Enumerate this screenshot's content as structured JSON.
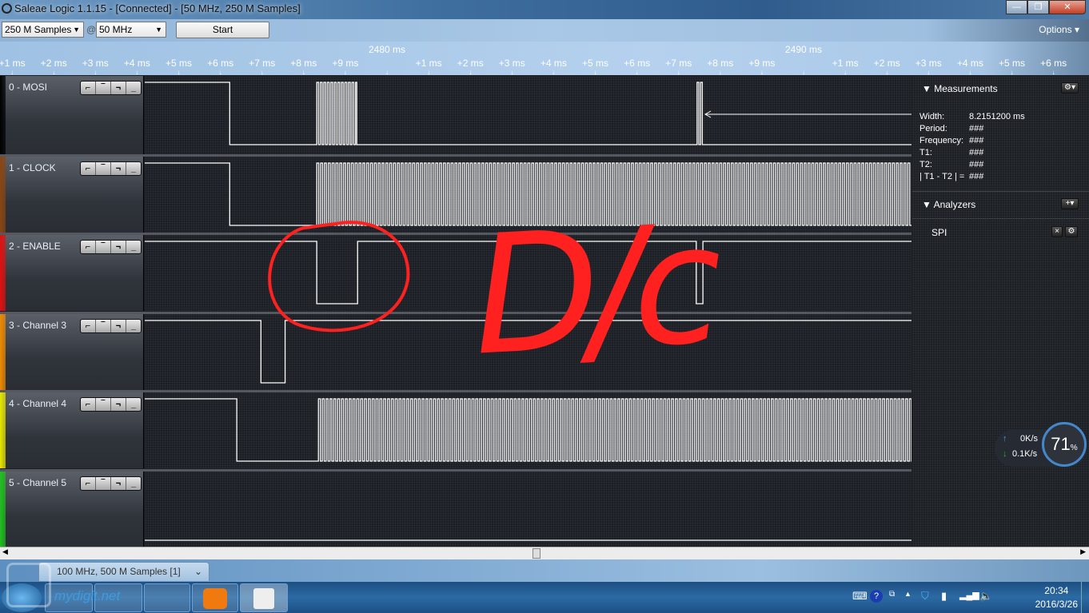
{
  "window": {
    "title": "Saleae Logic 1.1.15 - [Connected] - [50 MHz, 250 M Samples]"
  },
  "toolbar": {
    "samples": "250 M Samples",
    "at": "@",
    "rate": "50 MHz",
    "start_label": "Start",
    "options_label": "Options ▾"
  },
  "ruler": {
    "first_tick_ms": 2471,
    "ticks": [
      "+1 ms",
      "+2 ms",
      "+3 ms",
      "+4 ms",
      "+5 ms",
      "+6 ms",
      "+7 ms",
      "+8 ms",
      "+9 ms",
      "",
      "+1 ms",
      "+2 ms",
      "+3 ms",
      "+4 ms",
      "+5 ms",
      "+6 ms",
      "+7 ms",
      "+8 ms",
      "+9 ms",
      "",
      "+1 ms",
      "+2 ms",
      "+3 ms",
      "+4 ms",
      "+5 ms",
      "+6 ms",
      "+7"
    ],
    "major": [
      {
        "ms": 2480,
        "label": "2480 ms"
      },
      {
        "ms": 2490,
        "label": "2490 ms"
      }
    ],
    "view_start_ms": 2474.18,
    "view_end_ms": 2492.59
  },
  "channels": [
    {
      "name": "0 - MOSI",
      "color": "#000000",
      "segments": [
        [
          "high",
          2474.18,
          2476.22
        ],
        [
          "low",
          2476.22,
          2478.31
        ],
        [
          "toggle",
          2478.31,
          2479.27
        ],
        [
          "low",
          2479.27,
          2487.44
        ],
        [
          "toggle",
          2487.44,
          2487.58
        ],
        [
          "low",
          2487.58,
          2492.59
        ]
      ]
    },
    {
      "name": "1 - CLOCK",
      "color": "#8b4513",
      "segments": [
        [
          "high",
          2474.18,
          2476.22
        ],
        [
          "low",
          2476.22,
          2478.31
        ],
        [
          "toggle",
          2478.31,
          2492.59
        ]
      ]
    },
    {
      "name": "2 - ENABLE",
      "color": "#e01010",
      "segments": [
        [
          "high",
          2474.18,
          2478.31
        ],
        [
          "low",
          2478.31,
          2479.29
        ],
        [
          "high",
          2479.29,
          2487.42
        ],
        [
          "low",
          2487.42,
          2487.58
        ],
        [
          "high",
          2487.58,
          2492.59
        ]
      ]
    },
    {
      "name": "3 - Channel 3",
      "color": "#f08a00",
      "segments": [
        [
          "high",
          2474.18,
          2476.97
        ],
        [
          "low",
          2476.97,
          2477.55
        ],
        [
          "high",
          2477.55,
          2492.59
        ]
      ]
    },
    {
      "name": "4 - Channel 4",
      "color": "#e8e800",
      "segments": [
        [
          "high",
          2474.18,
          2476.39
        ],
        [
          "low",
          2476.39,
          2478.35
        ],
        [
          "toggle",
          2478.35,
          2492.59
        ]
      ]
    },
    {
      "name": "5 - Channel 5",
      "color": "#20c020",
      "segments": [
        [
          "low",
          2474.18,
          2492.59
        ]
      ]
    }
  ],
  "trigger_buttons": [
    "rising-edge",
    "high",
    "falling-edge",
    "low"
  ],
  "measurements": {
    "title": "Measurements",
    "rows": [
      {
        "k": "Width:",
        "v": "8.2151200 ms"
      },
      {
        "k": "Period:",
        "v": "###"
      },
      {
        "k": "Frequency:",
        "v": "###"
      },
      {
        "k": "T1:",
        "v": "###"
      },
      {
        "k": "T2:",
        "v": "###"
      },
      {
        "k": "| T1 - T2 | =",
        "v": "###"
      }
    ]
  },
  "analyzers": {
    "title": "Analyzers",
    "items": [
      "SPI"
    ]
  },
  "tabs": [
    {
      "label": "100 MHz, 500 M Samples [1]"
    }
  ],
  "network": {
    "up": "0K/s",
    "down": "0.1K/s",
    "percent": "71",
    "percent_sign": "%"
  },
  "clock": {
    "time": "20:34",
    "date": "2016/3/26"
  },
  "annotation": {
    "text": "D/c",
    "color": "#ff2020"
  },
  "watermark": {
    "text": "数码之家 mydigit.net"
  }
}
